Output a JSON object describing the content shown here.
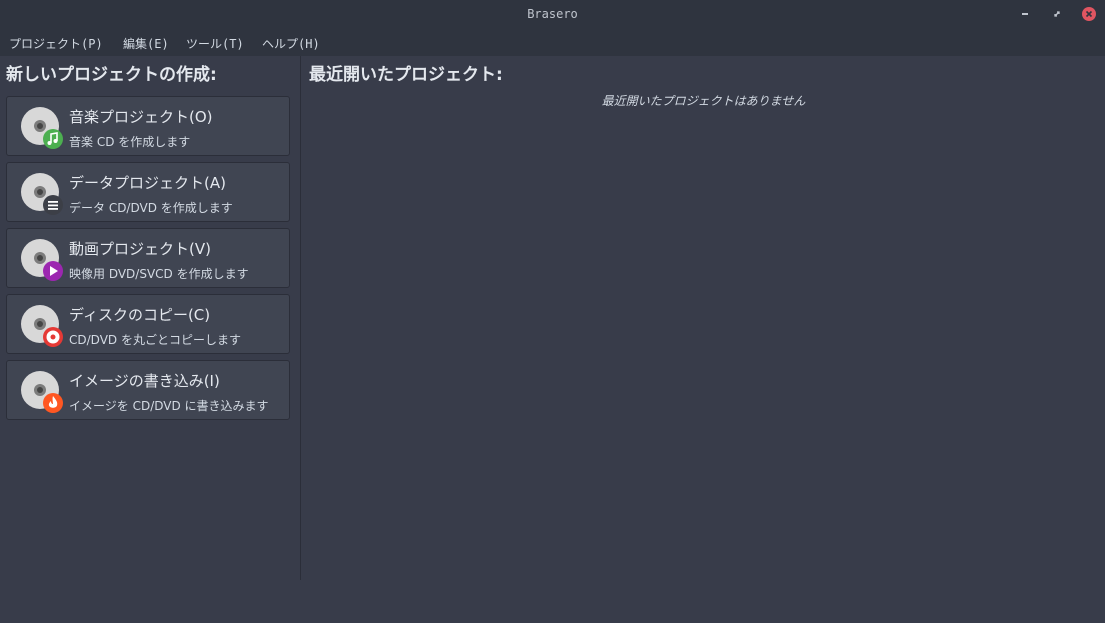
{
  "window": {
    "title": "Brasero"
  },
  "menu": [
    "プロジェクト(P)",
    "編集(E)",
    "ツール(T)",
    "ヘルプ(H)"
  ],
  "left": {
    "heading": "新しいプロジェクトの作成:",
    "projects": [
      {
        "name": "音楽プロジェクト(O)",
        "desc": "音楽 CD を作成します",
        "icon": "music-icon",
        "badge_color": "#4caf50"
      },
      {
        "name": "データプロジェクト(A)",
        "desc": "データ CD/DVD を作成します",
        "icon": "data-icon",
        "badge_color": "#3c3f47"
      },
      {
        "name": "動画プロジェクト(V)",
        "desc": "映像用 DVD/SVCD を作成します",
        "icon": "video-icon",
        "badge_color": "#9c27b0"
      },
      {
        "name": "ディスクのコピー(C)",
        "desc": "CD/DVD を丸ごとコピーします",
        "icon": "copy-icon",
        "badge_color": "#e53935"
      },
      {
        "name": "イメージの書き込み(I)",
        "desc": "イメージを CD/DVD に書き込みます",
        "icon": "burn-icon",
        "badge_color": "#ff5722"
      }
    ]
  },
  "right": {
    "heading": "最近開いたプロジェクト:",
    "empty_message": "最近開いたプロジェクトはありません"
  }
}
